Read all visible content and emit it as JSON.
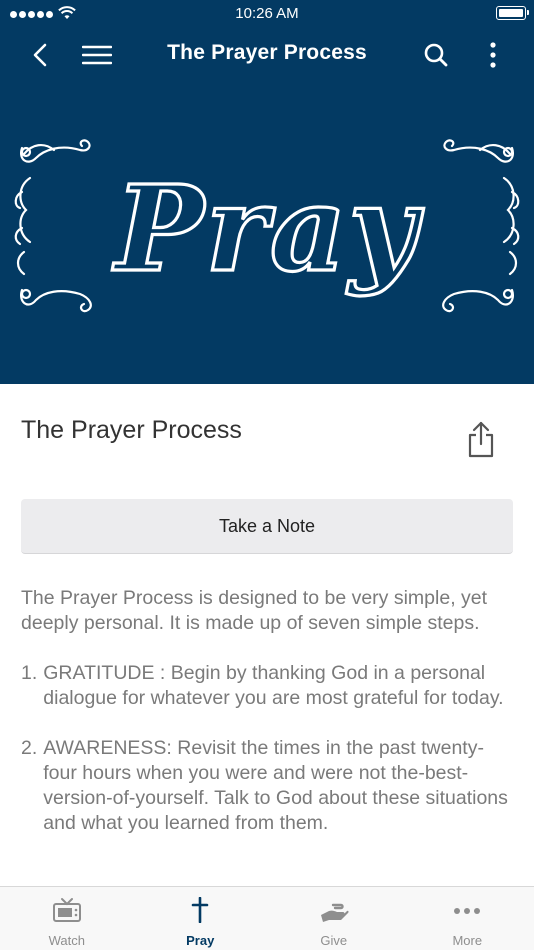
{
  "status_bar": {
    "time": "10:26 AM"
  },
  "header": {
    "title": "The Prayer Process"
  },
  "hero": {
    "image_word": "Pray"
  },
  "page": {
    "title": "The Prayer Process",
    "note_button": "Take a Note",
    "intro": "The Prayer Process is designed to be very simple, yet deeply personal. It is made up of seven simple steps.",
    "steps": [
      {
        "number": "1.",
        "text": "GRATITUDE : Begin by thanking God in a personal dialogue for whatever you are most grateful for today."
      },
      {
        "number": "2.",
        "text": "AWARENESS: Revisit the times in the past twenty-four hours when you were and were not the-best-version-of-yourself. Talk to God about these situations and what you learned from them."
      }
    ]
  },
  "tabs": [
    {
      "label": "Watch",
      "icon": "tv-icon"
    },
    {
      "label": "Pray",
      "icon": "cross-icon",
      "active": true
    },
    {
      "label": "Give",
      "icon": "giving-hand-icon"
    },
    {
      "label": "More",
      "icon": "more-dots-icon"
    }
  ],
  "colors": {
    "primary": "#033a63",
    "tab_inactive": "#8e8e8e",
    "body_text": "#7a7a7a"
  }
}
